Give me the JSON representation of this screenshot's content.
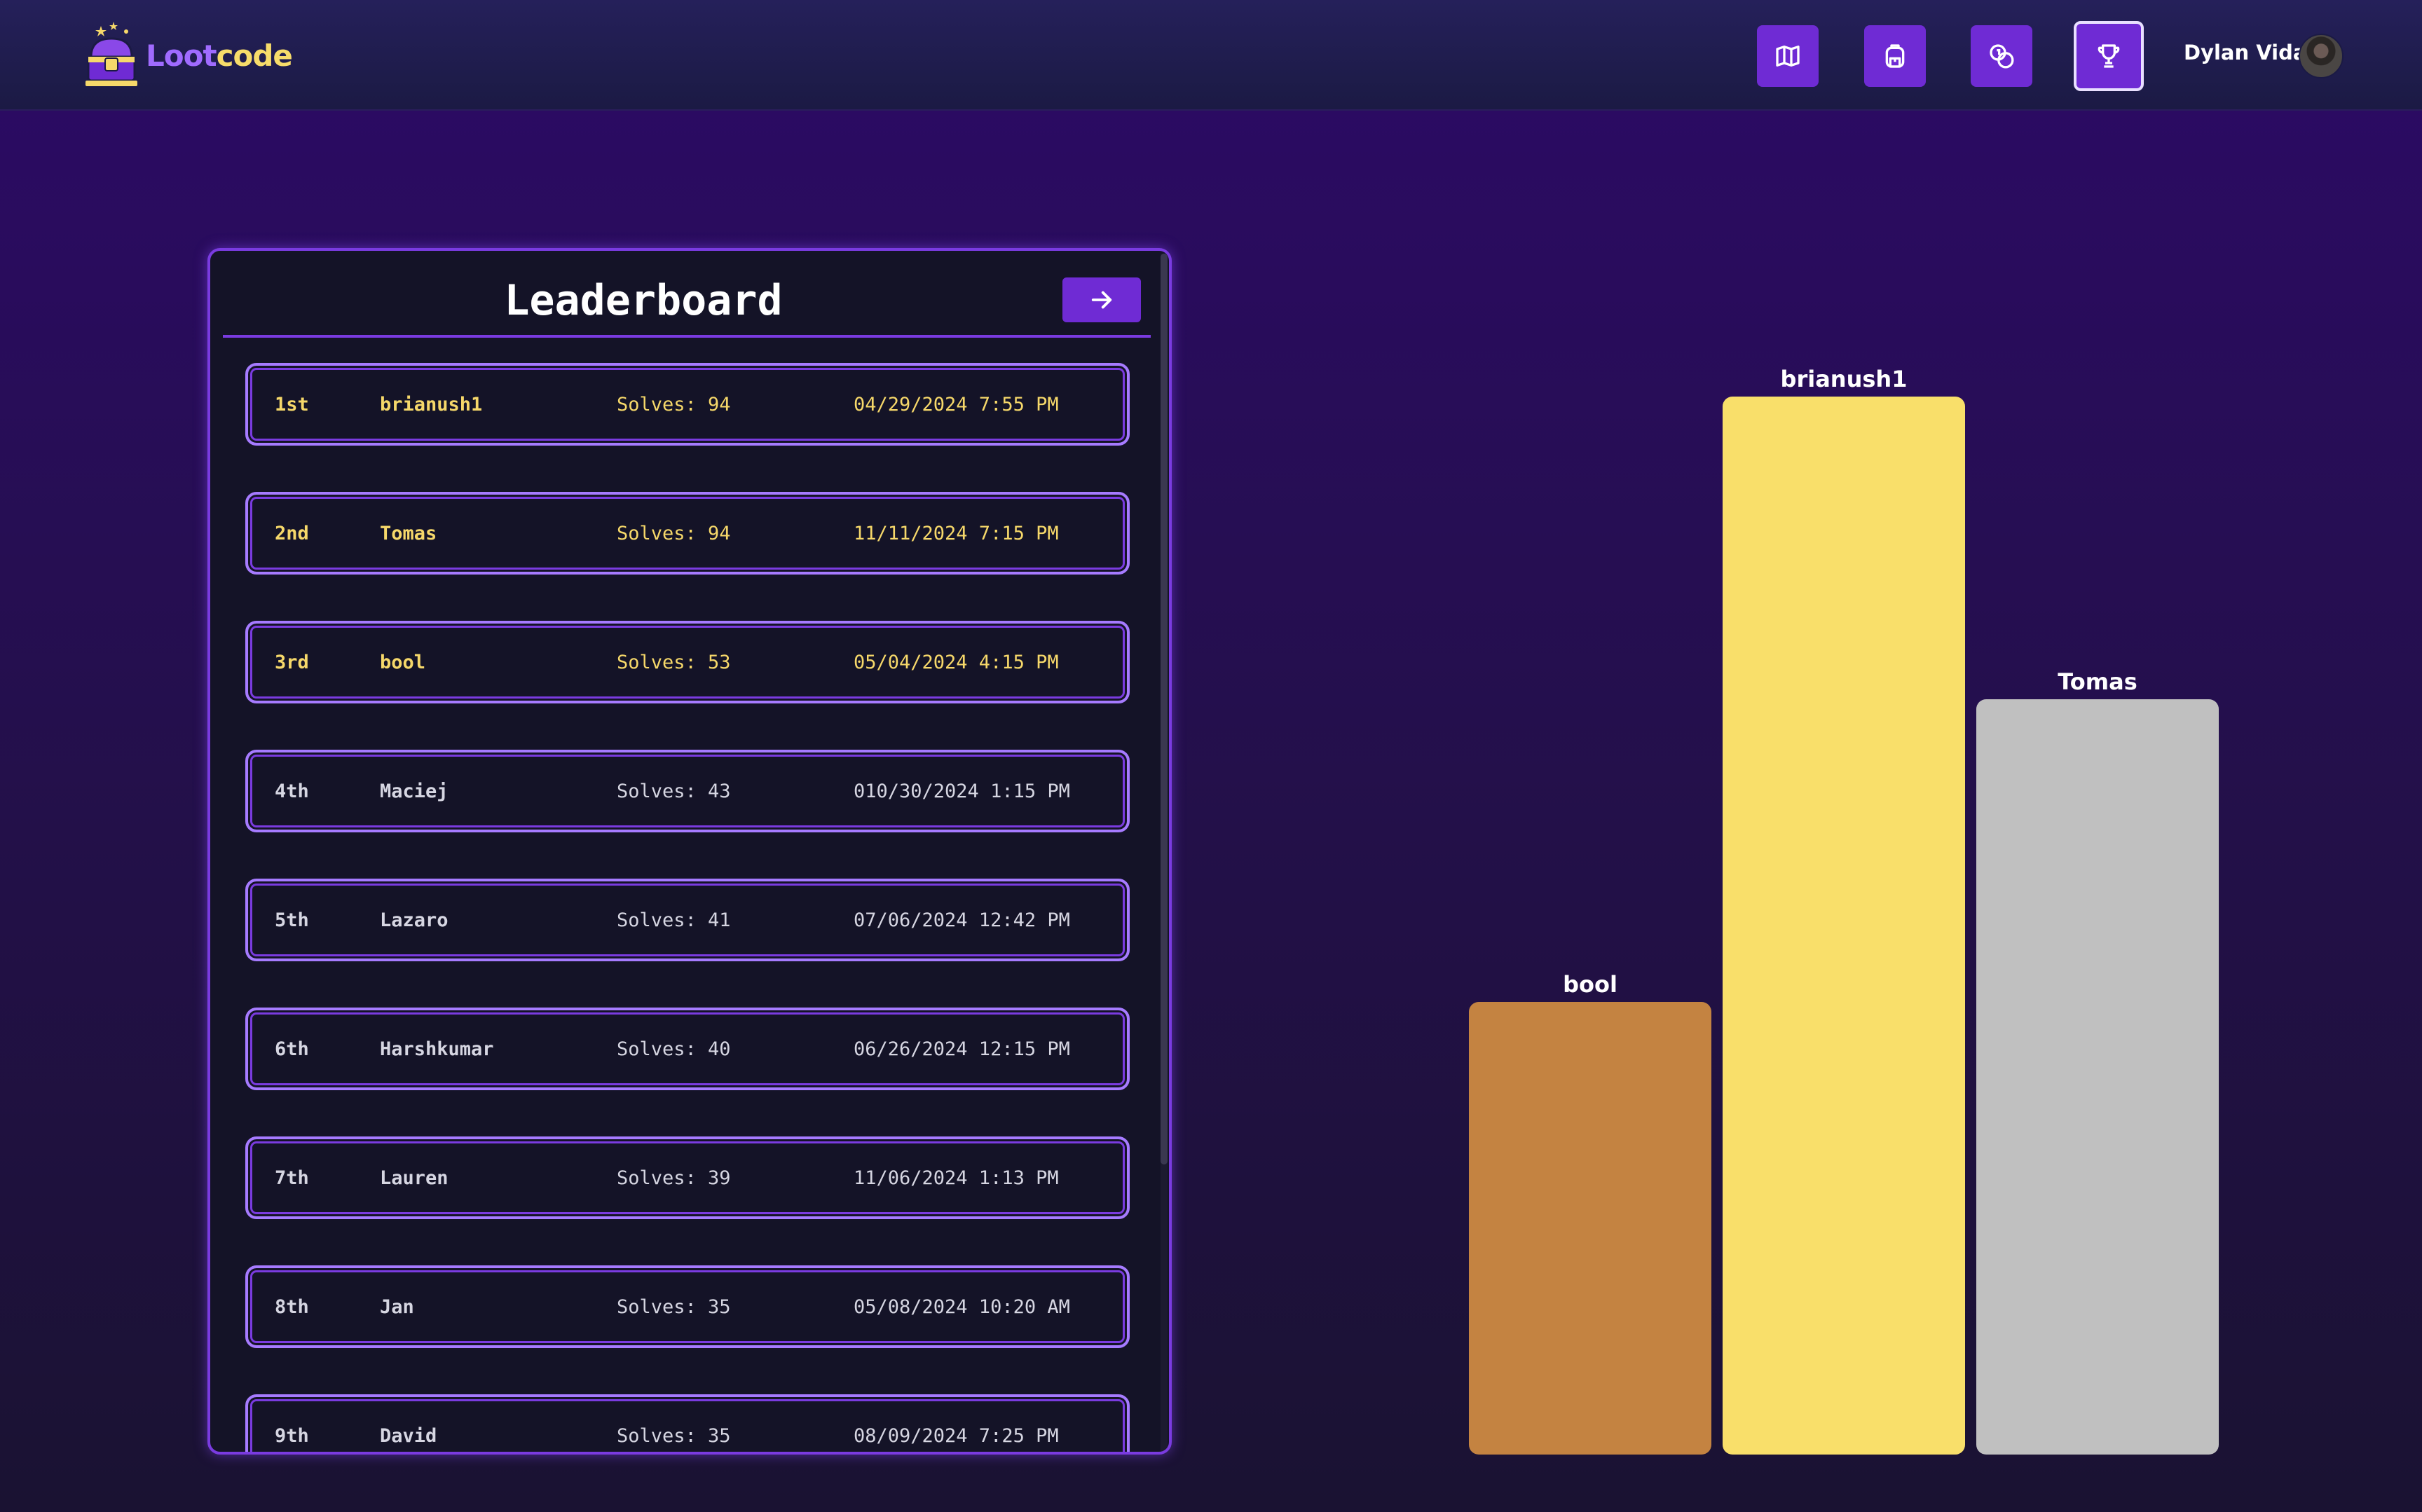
{
  "app": {
    "logo_part1": "Loot",
    "logo_part2": "code"
  },
  "nav": {
    "icons": [
      "map-icon",
      "backpack-icon",
      "coins-icon",
      "trophy-icon"
    ],
    "active": "trophy-icon"
  },
  "user": {
    "name": "Dylan Vidal"
  },
  "leaderboard": {
    "title": "Leaderboard",
    "rows": [
      {
        "rank": "1st",
        "name": "brianush1",
        "solves": "Solves: 94",
        "date": "04/29/2024 7:55 PM"
      },
      {
        "rank": "2nd",
        "name": "Tomas",
        "solves": "Solves: 94",
        "date": "11/11/2024 7:15 PM"
      },
      {
        "rank": "3rd",
        "name": "bool",
        "solves": "Solves: 53",
        "date": "05/04/2024 4:15 PM"
      },
      {
        "rank": "4th",
        "name": "Maciej",
        "solves": "Solves: 43",
        "date": "010/30/2024 1:15 PM"
      },
      {
        "rank": "5th",
        "name": "Lazaro",
        "solves": "Solves: 41",
        "date": "07/06/2024 12:42 PM"
      },
      {
        "rank": "6th",
        "name": "Harshkumar",
        "solves": "Solves: 40",
        "date": "06/26/2024 12:15 PM"
      },
      {
        "rank": "7th",
        "name": "Lauren",
        "solves": "Solves: 39",
        "date": "11/06/2024 1:13 PM"
      },
      {
        "rank": "8th",
        "name": "Jan",
        "solves": "Solves: 35",
        "date": "05/08/2024 10:20 AM"
      },
      {
        "rank": "9th",
        "name": "David",
        "solves": "Solves: 35",
        "date": "08/09/2024 7:25 PM"
      }
    ]
  },
  "podium": {
    "first": {
      "name": "brianush1",
      "color": "#f9df6a"
    },
    "second": {
      "name": "Tomas",
      "color": "#c0c0c0"
    },
    "third": {
      "name": "bool",
      "color": "#c48341"
    }
  },
  "colors": {
    "accent": "#6f2bd4",
    "panel_border": "#7a3be0",
    "top_rank_text": "#f6d86a"
  }
}
